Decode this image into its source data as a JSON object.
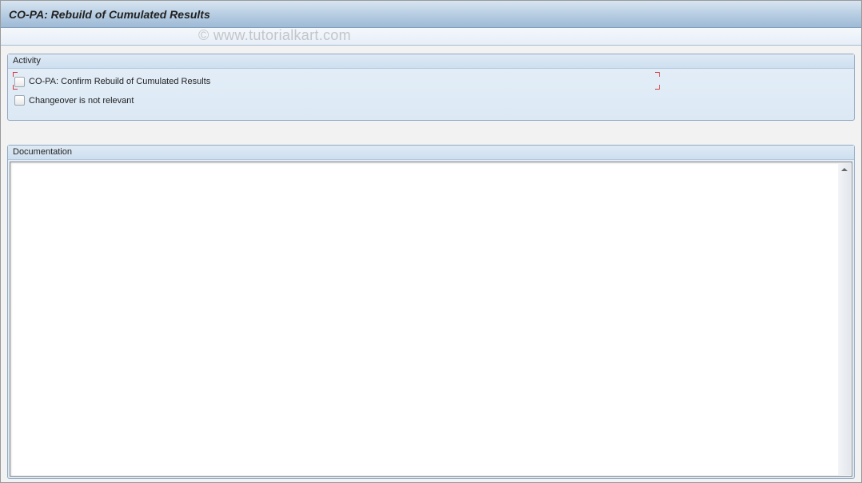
{
  "title": "CO-PA: Rebuild of Cumulated Results",
  "watermark": "© www.tutorialkart.com",
  "activity": {
    "group_label": "Activity",
    "confirm_label": "CO-PA: Confirm Rebuild of Cumulated Results",
    "changeover_label": "Changeover is not relevant"
  },
  "documentation": {
    "group_label": "Documentation"
  }
}
